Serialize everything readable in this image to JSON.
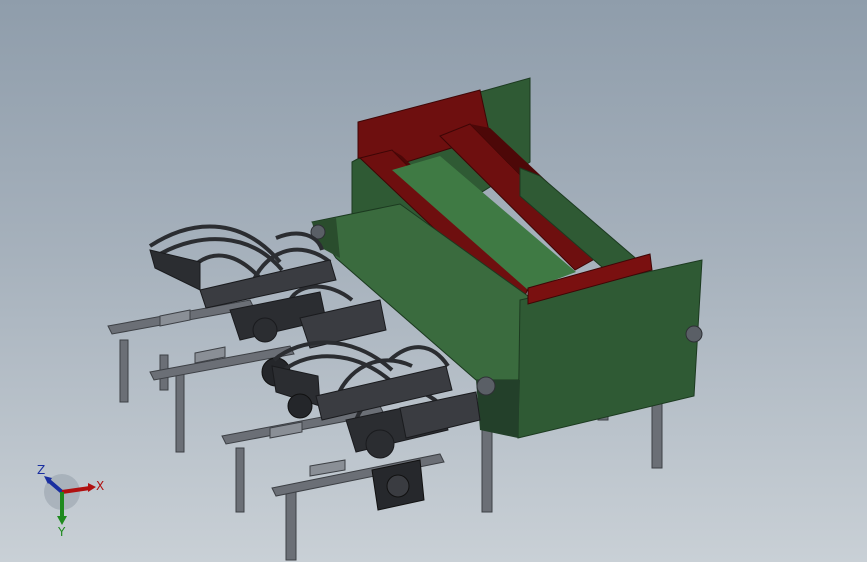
{
  "viewport": {
    "background_top": "#8f9dab",
    "background_bottom": "#c9d0d6"
  },
  "model": {
    "colors": {
      "green": "#2f5a34",
      "green_light": "#3f7a44",
      "red": "#6e0f0f",
      "red_dark": "#4d0808",
      "frame": "#6b6f76",
      "frame_dark": "#3d4045",
      "mechanism": "#2b2d31"
    }
  },
  "triad": {
    "x_label": "X",
    "y_label": "Y",
    "z_label": "Z",
    "x_color": "#b01010",
    "y_color": "#1f8a1f",
    "z_color": "#1a2fa0"
  }
}
